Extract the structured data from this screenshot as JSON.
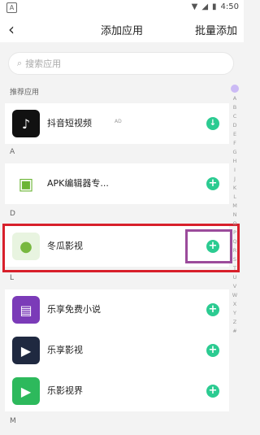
{
  "status_bar": {
    "time": "4:50",
    "left_icon": "notification-icon"
  },
  "header": {
    "back_icon": "back-chevron-icon",
    "title": "添加应用",
    "action": "批量添加"
  },
  "search": {
    "placeholder": "搜索应用",
    "icon": "search-icon"
  },
  "sections": {
    "recommended": "推荐应用",
    "a": "A",
    "d": "D",
    "l": "L",
    "m": "M"
  },
  "apps": [
    {
      "name": "抖音短视频",
      "badge": "AD",
      "action_icon": "download-icon",
      "icon_color": "#111111"
    },
    {
      "name": "APK编辑器专...",
      "action_icon": "plus-icon",
      "icon_color": "#ffffff"
    },
    {
      "name": "冬瓜影视",
      "action_icon": "plus-icon",
      "icon_color": "#e8f4e0"
    },
    {
      "name": "乐享免费小说",
      "action_icon": "plus-icon",
      "icon_color": "#7b3bb8"
    },
    {
      "name": "乐享影视",
      "action_icon": "plus-icon",
      "icon_color": "#1f2940"
    },
    {
      "name": "乐影视界",
      "action_icon": "plus-icon",
      "icon_color": "#2db95c"
    }
  ],
  "index_letters": [
    "A",
    "B",
    "C",
    "D",
    "E",
    "F",
    "G",
    "H",
    "I",
    "J",
    "K",
    "L",
    "M",
    "N",
    "O",
    "P",
    "Q",
    "R",
    "S",
    "T",
    "U",
    "V",
    "W",
    "X",
    "Y",
    "Z",
    "#"
  ],
  "colors": {
    "accent_green": "#2bcb91",
    "highlight_red": "#d8202b",
    "highlight_purple": "#9b4b9b"
  }
}
